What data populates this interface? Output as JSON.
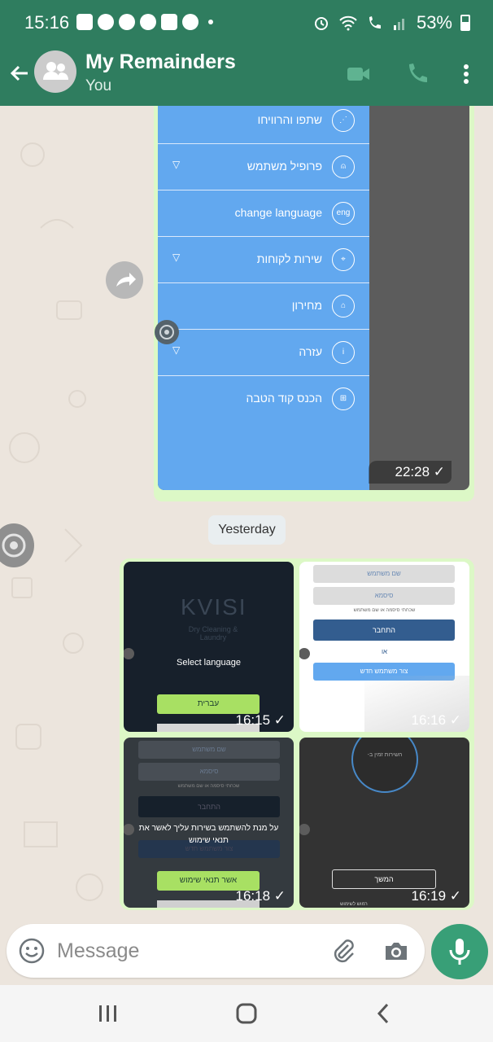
{
  "status_bar": {
    "time": "15:16",
    "battery": "53%",
    "app_icons": [
      "message-icon",
      "skype-icon",
      "facebook-icon",
      "facebook-icon",
      "youtube-icon",
      "account-icon"
    ]
  },
  "header": {
    "title": "My Remainders",
    "subtitle": "You",
    "icons": [
      "back-arrow-icon",
      "group-avatar-icon",
      "video-call-icon",
      "phone-icon",
      "more-vert-icon"
    ]
  },
  "messages": {
    "first": {
      "menu_items": [
        {
          "label": "שתפו והרוויחו",
          "icon": "share-icon",
          "has_arrow": false
        },
        {
          "label": "פרופיל משתמש",
          "icon": "user-icon",
          "has_arrow": true
        },
        {
          "label": "change language",
          "icon": "eng",
          "has_arrow": false
        },
        {
          "label": "שירות לקוחות",
          "icon": "location-icon",
          "has_arrow": true
        },
        {
          "label": "מחירון",
          "icon": "tag-icon",
          "has_arrow": false
        },
        {
          "label": "עזרה",
          "icon": "info-icon",
          "has_arrow": true
        },
        {
          "label": "הכנס קוד הטבה",
          "icon": "gift-icon",
          "has_arrow": false
        }
      ],
      "time": "22:28"
    },
    "date_divider": "Yesterday",
    "gallery": {
      "tiles": [
        {
          "time": "16:15",
          "logo": "KVISI",
          "logo_sub": "Dry Cleaning & Laundry",
          "select_language": "Select language",
          "button": "עברית"
        },
        {
          "time": "16:16",
          "username": "שם משתמש",
          "password": "סיסמא",
          "forgot": "שכחתי סיסמה או שם משתמש",
          "login": "התחבר",
          "or": "או",
          "new_user": "צור משתמש חדש"
        },
        {
          "time": "16:18",
          "username": "שם משתמש",
          "password": "סיסמא",
          "forgot": "שכחתי סיסמה או שם משתמש",
          "login": "התחבר",
          "terms_line1": "על מנת להשתמש בשירות עליך לאשר את",
          "terms_line2": "תנאי שימוש",
          "new_user": "צור משתמש חדש",
          "accept": "אשר תנאי שימוש"
        },
        {
          "time": "16:19",
          "circle_text": "השירות זמין ב-",
          "continue": "המשך",
          "terms": "רמוש לשימוש"
        }
      ]
    }
  },
  "composer": {
    "placeholder": "Message",
    "icons": [
      "emoji-icon",
      "attach-icon",
      "camera-icon",
      "mic-icon"
    ]
  },
  "nav_bar": {
    "icons": [
      "recents-icon",
      "home-icon",
      "back-icon"
    ]
  },
  "colors": {
    "header": "#2f7d5f",
    "bubble": "#dcf8c6",
    "menu_blue": "#62a8ef",
    "mic_button": "#389f77"
  }
}
